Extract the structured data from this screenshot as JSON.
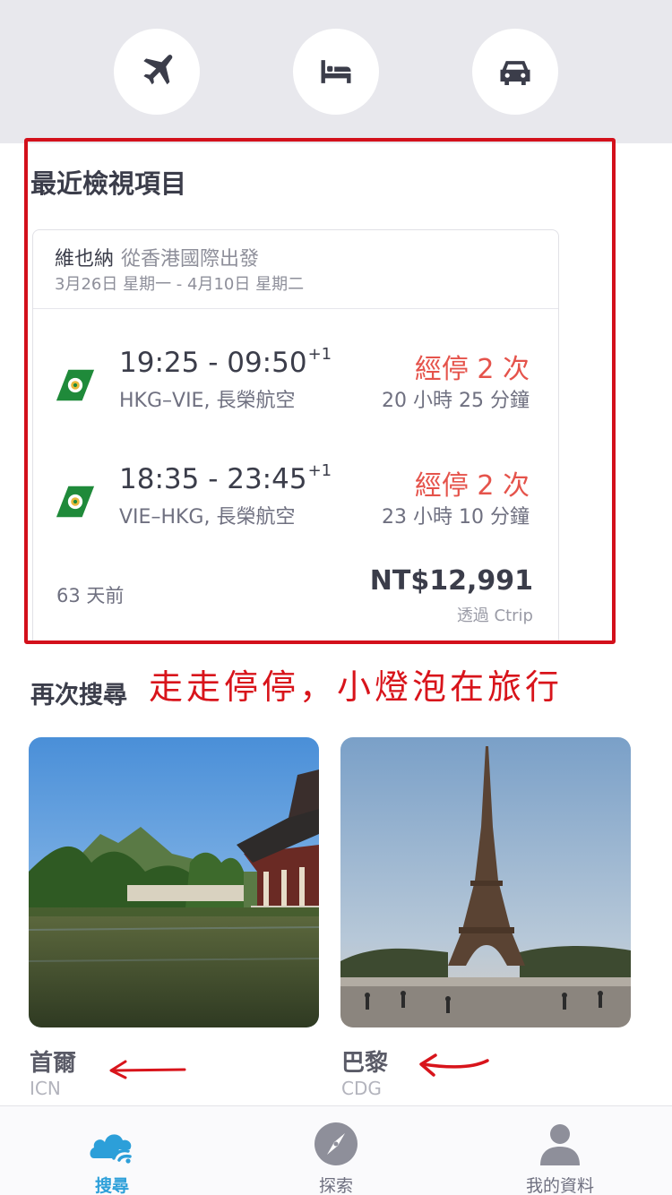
{
  "categories": [
    {
      "name": "flights",
      "icon": "airplane-icon"
    },
    {
      "name": "hotels",
      "icon": "bed-icon"
    },
    {
      "name": "car-hire",
      "icon": "car-icon"
    }
  ],
  "recent": {
    "title": "最近檢視項目",
    "destination": "維也納",
    "origin": "從香港國際出發",
    "dates": "3月26日 星期一 - 4月10日 星期二",
    "legs": [
      {
        "time": "19:25 - 09:50",
        "day_offset": "+1",
        "route": "HKG–VIE, 長榮航空",
        "stops": "經停 2 次",
        "duration": "20 小時 25 分鐘",
        "airline_icon": "eva-air-logo-icon"
      },
      {
        "time": "18:35 - 23:45",
        "day_offset": "+1",
        "route": "VIE–HKG, 長榮航空",
        "stops": "經停 2 次",
        "duration": "23 小時 10 分鐘",
        "airline_icon": "eva-air-logo-icon"
      }
    ],
    "ago": "63 天前",
    "price": "NT$12,991",
    "via": "透過 Ctrip"
  },
  "search_again": {
    "title": "再次搜尋",
    "handwritten_note": "走走停停，小燈泡在旅行",
    "cities": [
      {
        "name": "首爾",
        "code": "ICN"
      },
      {
        "name": "巴黎",
        "code": "CDG"
      }
    ]
  },
  "tabs": [
    {
      "label": "搜尋",
      "icon": "cloud-search-icon",
      "active": true
    },
    {
      "label": "探索",
      "icon": "compass-icon",
      "active": false
    },
    {
      "label": "我的資料",
      "icon": "profile-icon",
      "active": false
    }
  ],
  "colors": {
    "accent": "#2c9fd9",
    "stops_red": "#e5534b",
    "annotation_red": "#d3101b",
    "strip_bg": "#e8e8ed"
  }
}
